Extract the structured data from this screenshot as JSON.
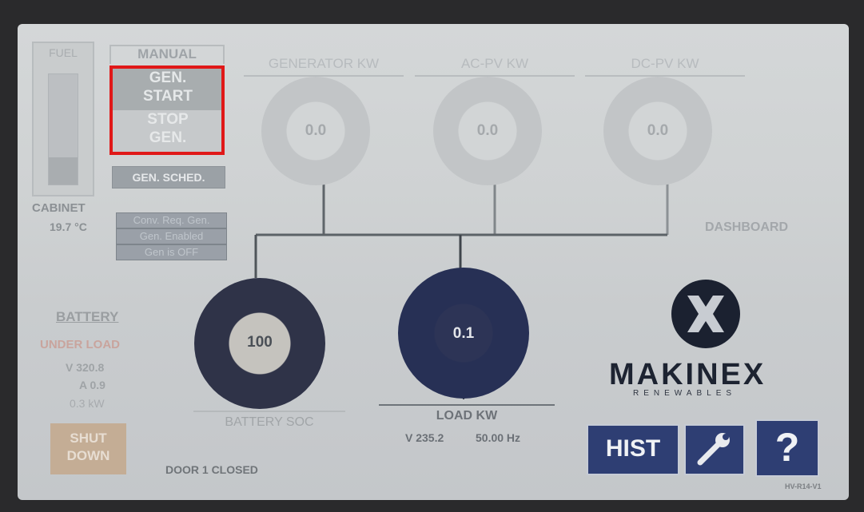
{
  "fuel": {
    "label": "FUEL",
    "level_fraction": 0.25
  },
  "manual": {
    "label": "MANUAL",
    "gen_start": [
      "GEN.",
      "START"
    ],
    "stop_gen": [
      "STOP",
      "GEN."
    ],
    "gen_sched": "GEN. SCHED."
  },
  "cabinet": {
    "label": "CABINET",
    "temp": "19.7 °C"
  },
  "status": [
    "Conv. Req. Gen.",
    "Gen.  Enabled",
    "Gen is OFF"
  ],
  "gauges": {
    "generator": {
      "title": "GENERATOR KW",
      "value": "0.0"
    },
    "ac_pv": {
      "title": "AC-PV KW",
      "value": "0.0"
    },
    "dc_pv": {
      "title": "DC-PV KW",
      "value": "0.0"
    }
  },
  "dashboard": "DASHBOARD",
  "battery": {
    "title": "BATTERY",
    "state": "UNDER LOAD",
    "voltage": "V  320.8",
    "current": "A  0.9",
    "power": "0.3 kW"
  },
  "battery_soc": {
    "label": "BATTERY SOC",
    "value": "100",
    "percent": 100
  },
  "load": {
    "label": "LOAD KW",
    "value": "0.1",
    "voltage": "V 235.2",
    "frequency": "50.00  Hz"
  },
  "shutdown": [
    "SHUT",
    "DOWN"
  ],
  "door": "DOOR 1 CLOSED",
  "buttons": {
    "hist": "HIST",
    "help": "?"
  },
  "logo": {
    "name": "MAKINEX",
    "sub": "RENEWABLES"
  },
  "version": "HV-R14-V1",
  "colors": {
    "button_bg": "#2e3e73",
    "highlight": "#e01818",
    "ring": "#c2c5c7"
  }
}
